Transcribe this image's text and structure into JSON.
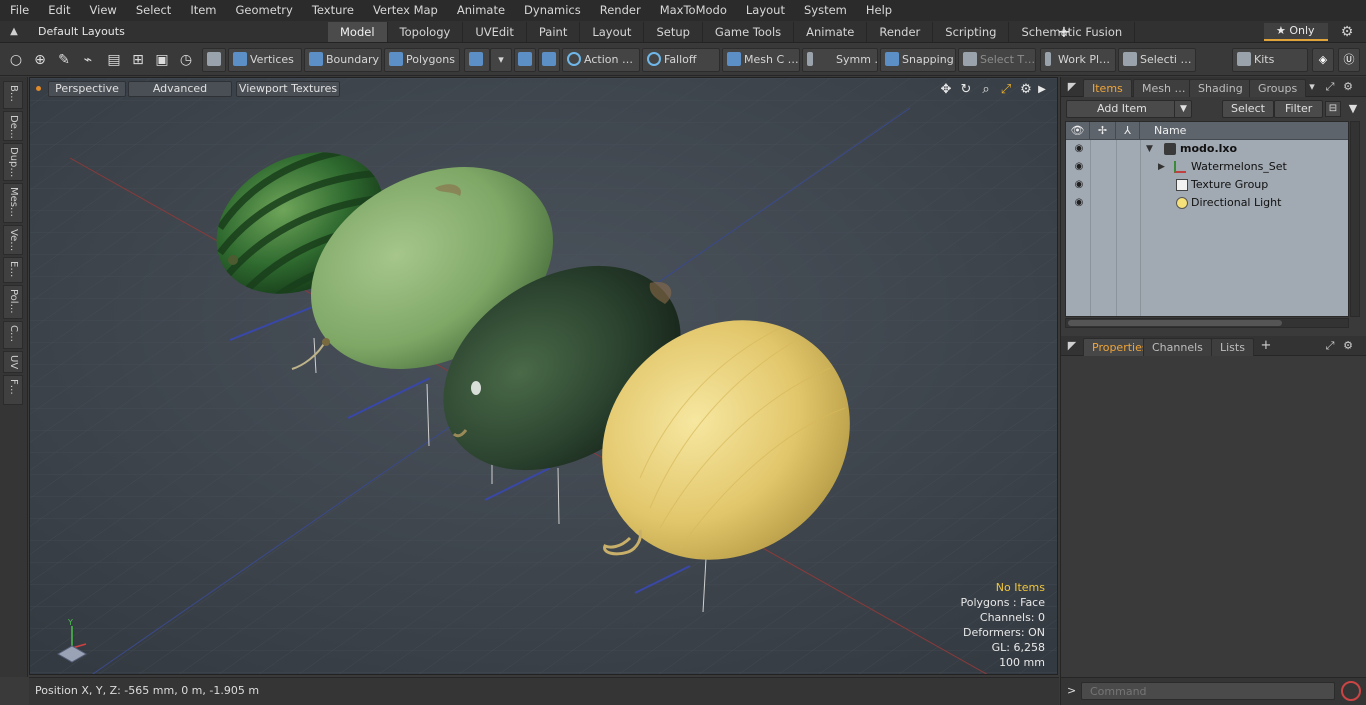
{
  "menu": [
    "File",
    "Edit",
    "View",
    "Select",
    "Item",
    "Geometry",
    "Texture",
    "Vertex Map",
    "Animate",
    "Dynamics",
    "Render",
    "MaxToModo",
    "Layout",
    "System",
    "Help"
  ],
  "layouts": {
    "selector": "Default Layouts ▾",
    "tabs": [
      "Model",
      "Topology",
      "UVEdit",
      "Paint",
      "Layout",
      "Setup",
      "Game Tools",
      "Animate",
      "Render",
      "Scripting",
      "Schematic Fusion"
    ],
    "active_tab": "Model",
    "only_label": "★  Only"
  },
  "toolbar": {
    "vertices": "Vertices",
    "boundary": "Boundary",
    "polygons": "Polygons",
    "action": "Action   …",
    "falloff": "Falloff",
    "mesh_c": "Mesh C …",
    "symm": "Symm …",
    "snapping": "Snapping",
    "select_t": "Select T…",
    "work_pl": "Work Pl…",
    "selecti": "Selecti …",
    "kits": "Kits"
  },
  "left_strip": [
    "B…",
    "De…",
    "Dup…",
    "Mes…",
    "Ve…",
    "E…",
    "Pol…",
    "C…",
    "UV",
    "F…"
  ],
  "viewport": {
    "perspective": "Perspective",
    "advanced": "Advanced",
    "textures": "Viewport Textures",
    "info": {
      "selection": "No Items",
      "polygons": "Polygons : Face",
      "channels": "Channels: 0",
      "deformers": "Deformers: ON",
      "gl": "GL: 6,258",
      "scale": "100 mm"
    }
  },
  "status": {
    "position": "Position X, Y, Z:   -565 mm, 0 m, -1.905 m"
  },
  "items_panel": {
    "tabs": [
      "Items",
      "Mesh …",
      "Shading",
      "Groups"
    ],
    "active_tab": "Items",
    "add_item": "Add Item",
    "select": "Select",
    "filter": "Filter",
    "name_header": "Name",
    "rows": [
      {
        "label": "modo.lxo",
        "bold": true
      },
      {
        "label": "Watermelons_Set",
        "bold": false
      },
      {
        "label": "Texture Group",
        "bold": false
      },
      {
        "label": "Directional Light",
        "bold": false
      }
    ]
  },
  "properties_panel": {
    "tabs": [
      "Properties",
      "Channels",
      "Lists"
    ],
    "active_tab": "Properties"
  },
  "command": {
    "prompt": ">",
    "placeholder": "Command"
  },
  "colors": {
    "accent": "#f0a53a",
    "viewport_bg": "#3e454d",
    "info_highlight": "#f0c63c"
  }
}
